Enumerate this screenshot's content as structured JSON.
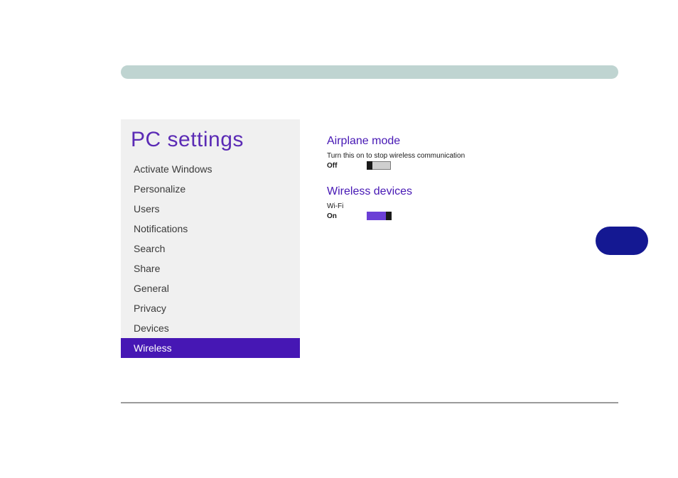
{
  "sidebar": {
    "title": "PC settings",
    "items": [
      {
        "label": "Activate Windows",
        "selected": false
      },
      {
        "label": "Personalize",
        "selected": false
      },
      {
        "label": "Users",
        "selected": false
      },
      {
        "label": "Notifications",
        "selected": false
      },
      {
        "label": "Search",
        "selected": false
      },
      {
        "label": "Share",
        "selected": false
      },
      {
        "label": "General",
        "selected": false
      },
      {
        "label": "Privacy",
        "selected": false
      },
      {
        "label": "Devices",
        "selected": false
      },
      {
        "label": "Wireless",
        "selected": true
      }
    ]
  },
  "content": {
    "airplane": {
      "heading": "Airplane mode",
      "description": "Turn this on to stop wireless communication",
      "state_label": "Off",
      "state": "off"
    },
    "wireless": {
      "heading": "Wireless devices",
      "device_label": "Wi-Fi",
      "state_label": "On",
      "state": "on"
    }
  },
  "colors": {
    "accent": "#4617b4",
    "top_bar": "#bfd4d1",
    "side_pill": "#141892"
  }
}
